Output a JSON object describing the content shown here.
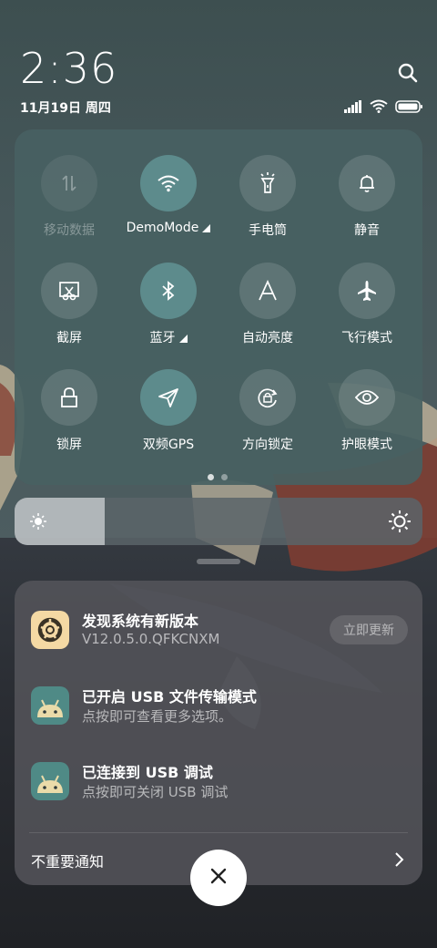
{
  "status": {
    "time": "2:36",
    "date": "11月19日 周四",
    "icons": [
      "signal-icon",
      "wifi-icon",
      "battery-icon"
    ]
  },
  "quick_settings": {
    "tiles": [
      {
        "label": "移动数据",
        "icon": "mobile-data-icon",
        "state": "disabled"
      },
      {
        "label": "DemoMode",
        "icon": "wifi-icon",
        "state": "active",
        "expandable": true
      },
      {
        "label": "手电筒",
        "icon": "flashlight-icon",
        "state": "off"
      },
      {
        "label": "静音",
        "icon": "bell-icon",
        "state": "off"
      },
      {
        "label": "截屏",
        "icon": "screenshot-icon",
        "state": "off"
      },
      {
        "label": "蓝牙",
        "icon": "bluetooth-icon",
        "state": "active",
        "expandable": true
      },
      {
        "label": "自动亮度",
        "icon": "auto-brightness-icon",
        "state": "off"
      },
      {
        "label": "飞行模式",
        "icon": "airplane-icon",
        "state": "off"
      },
      {
        "label": "锁屏",
        "icon": "lock-icon",
        "state": "off"
      },
      {
        "label": "双频GPS",
        "icon": "location-icon",
        "state": "active"
      },
      {
        "label": "方向锁定",
        "icon": "rotation-lock-icon",
        "state": "off"
      },
      {
        "label": "护眼模式",
        "icon": "eye-icon",
        "state": "off"
      }
    ],
    "page_count": 2,
    "current_page": 1
  },
  "brightness": {
    "level": 0.22
  },
  "notifications": [
    {
      "title": "发现系统有新版本",
      "subtitle": "V12.0.5.0.QFKCNXM",
      "icon": "update-app-icon",
      "action": "立即更新"
    },
    {
      "title": "已开启 USB 文件传输模式",
      "subtitle": "点按即可查看更多选项。",
      "icon": "android-icon"
    },
    {
      "title": "已连接到 USB 调试",
      "subtitle": "点按即可关闭 USB 调试",
      "icon": "android-icon"
    }
  ],
  "less_important": "不重要通知",
  "colors": {
    "panel": "#486162",
    "active_tile": "#5d8b8c",
    "notification_bg": "#55555a",
    "android_icon_bg": "#4f8a86",
    "update_icon_bg": "#f4d9a4"
  }
}
